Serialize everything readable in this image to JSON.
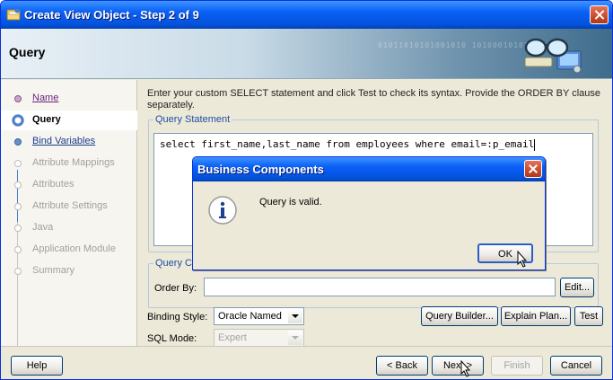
{
  "window": {
    "title": "Create View Object - Step 2 of 9",
    "header_title": "Query",
    "header_binary": "01011010101001010 10100010101",
    "header_icon": "glasses-wizard-icon"
  },
  "steps": [
    {
      "label": "Name",
      "state": "visited"
    },
    {
      "label": "Query",
      "state": "current"
    },
    {
      "label": "Bind Variables",
      "state": "link"
    },
    {
      "label": "Attribute Mappings",
      "state": "pending"
    },
    {
      "label": "Attributes",
      "state": "pending"
    },
    {
      "label": "Attribute Settings",
      "state": "pending"
    },
    {
      "label": "Java",
      "state": "pending"
    },
    {
      "label": "Application Module",
      "state": "pending"
    },
    {
      "label": "Summary",
      "state": "pending"
    }
  ],
  "content": {
    "instructions": "Enter your custom SELECT statement and click Test to check its syntax.  Provide the ORDER BY clause separately.",
    "query_legend": "Query Statement",
    "sql": "select first_name,last_name from employees where email=:p_email",
    "optional_legend": "Query C",
    "order_by_label": "Order By:",
    "order_by_value": "",
    "edit_label": "Edit...",
    "binding_style_label": "Binding Style:",
    "binding_style_value": "Oracle Named",
    "sql_mode_label": "SQL Mode:",
    "sql_mode_value": "Expert",
    "query_builder_label": "Query Builder...",
    "explain_plan_label": "Explain Plan...",
    "test_label": "Test"
  },
  "footer": {
    "help": "Help",
    "back": "< Back",
    "next": "Next >",
    "finish": "Finish",
    "cancel": "Cancel"
  },
  "dialog": {
    "title": "Business Components",
    "message": "Query is valid.",
    "ok": "OK",
    "icon": "info-icon"
  },
  "colors": {
    "titlebar": "#0453dd",
    "face": "#ece9d8",
    "legend": "#1f4ea3",
    "close": "#c94a2a"
  }
}
